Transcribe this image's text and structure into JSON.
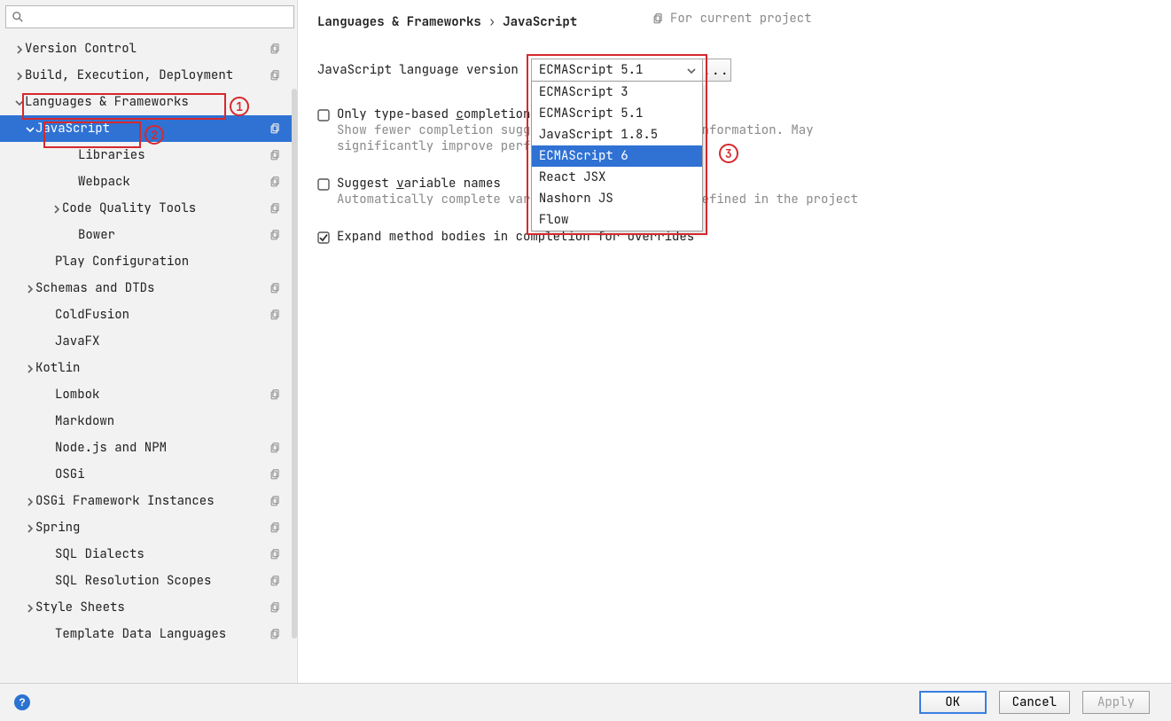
{
  "search_placeholder": "",
  "sidebar": {
    "items": [
      {
        "label": "Version Control",
        "indent": 0,
        "arrow": "right",
        "copy": true
      },
      {
        "label": "Build, Execution, Deployment",
        "indent": 0,
        "arrow": "right",
        "copy": true
      },
      {
        "label": "Languages & Frameworks",
        "indent": 0,
        "arrow": "down",
        "copy": false
      },
      {
        "label": "JavaScript",
        "indent": 1,
        "arrow": "down",
        "copy": true,
        "selected": true
      },
      {
        "label": "Libraries",
        "indent": 3,
        "arrow": "none",
        "copy": true
      },
      {
        "label": "Webpack",
        "indent": 3,
        "arrow": "none",
        "copy": true
      },
      {
        "label": "Code Quality Tools",
        "indent": "2b",
        "arrow": "right",
        "copy": true
      },
      {
        "label": "Bower",
        "indent": 3,
        "arrow": "none",
        "copy": true
      },
      {
        "label": "Play Configuration",
        "indent": 2,
        "arrow": "none",
        "copy": false
      },
      {
        "label": "Schemas and DTDs",
        "indent": 1,
        "arrow": "right",
        "copy": true
      },
      {
        "label": "ColdFusion",
        "indent": 2,
        "arrow": "none",
        "copy": true
      },
      {
        "label": "JavaFX",
        "indent": 2,
        "arrow": "none",
        "copy": false
      },
      {
        "label": "Kotlin",
        "indent": 1,
        "arrow": "right",
        "copy": false
      },
      {
        "label": "Lombok",
        "indent": 2,
        "arrow": "none",
        "copy": true
      },
      {
        "label": "Markdown",
        "indent": 2,
        "arrow": "none",
        "copy": false
      },
      {
        "label": "Node.js and NPM",
        "indent": 2,
        "arrow": "none",
        "copy": true
      },
      {
        "label": "OSGi",
        "indent": 2,
        "arrow": "none",
        "copy": true
      },
      {
        "label": "OSGi Framework Instances",
        "indent": 1,
        "arrow": "right",
        "copy": true
      },
      {
        "label": "Spring",
        "indent": 1,
        "arrow": "right",
        "copy": true
      },
      {
        "label": "SQL Dialects",
        "indent": 2,
        "arrow": "none",
        "copy": true
      },
      {
        "label": "SQL Resolution Scopes",
        "indent": 2,
        "arrow": "none",
        "copy": true
      },
      {
        "label": "Style Sheets",
        "indent": 1,
        "arrow": "right",
        "copy": true
      },
      {
        "label": "Template Data Languages",
        "indent": 2,
        "arrow": "none",
        "copy": true
      }
    ]
  },
  "breadcrumbs": {
    "a": "Languages & Frameworks",
    "sep": "›",
    "b": "JavaScript"
  },
  "for_current_project": "For current project",
  "lang_version_label": "JavaScript language version",
  "combo_value": "ECMAScript 5.1",
  "combo_extra": "...",
  "dropdown_items": [
    "ECMAScript 3",
    "ECMAScript 5.1",
    "JavaScript 1.8.5",
    "ECMAScript 6",
    "React JSX",
    "Nashorn JS",
    "Flow"
  ],
  "dropdown_selected_index": 3,
  "check1": {
    "label_pre": "Only type-based ",
    "label_u": "c",
    "label_post": "ompletion in the entry",
    "sub": "Show fewer completion suggestions based on type information. May significantly improve performance."
  },
  "check2": {
    "label_pre": "Suggest ",
    "label_u": "v",
    "label_post": "ariable names",
    "sub": "Automatically complete variable names and types defined in the project"
  },
  "check3": {
    "label": "Expand method bodies in completion for overrides"
  },
  "annotations": {
    "one": "1",
    "two": "2",
    "three": "3"
  },
  "buttons": {
    "ok": "OK",
    "cancel": "Cancel",
    "apply": "Apply"
  },
  "help_glyph": "?"
}
